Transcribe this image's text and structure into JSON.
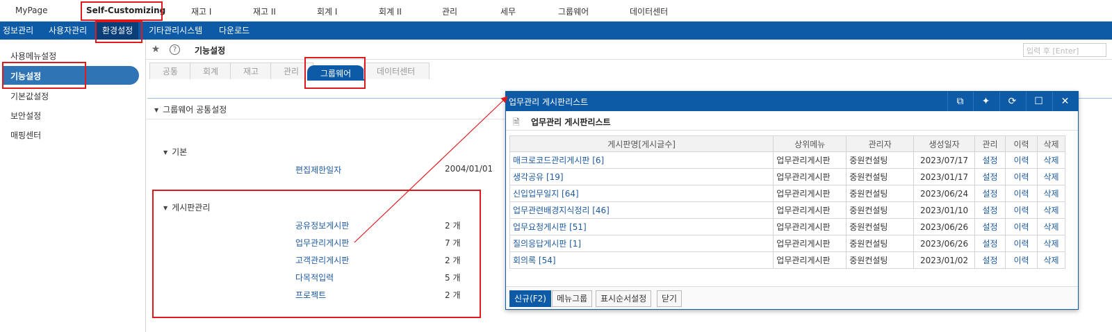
{
  "top_menu": [
    "MyPage",
    "Self-Customizing",
    "재고 I",
    "재고 II",
    "회계 I",
    "회계 II",
    "관리",
    "세무",
    "그룹웨어",
    "데이터센터"
  ],
  "sub_nav": [
    "정보관리",
    "사용자관리",
    "환경설정",
    "기타관리시스템",
    "다운로드"
  ],
  "sidebar": [
    "사용메뉴설정",
    "기능설정",
    "기본값설정",
    "보안설정",
    "매핑센터"
  ],
  "page": {
    "title": "기능설정",
    "search_placeholder": "입력 후 [Enter]"
  },
  "tabs": [
    "공통",
    "회계",
    "재고",
    "관리",
    "그룹웨어",
    "데이터센터"
  ],
  "settings": {
    "section_title": "그룹웨어 공통설정",
    "basic": {
      "title": "기본",
      "label": "편집제한일자",
      "value": "2004/01/01"
    },
    "board": {
      "title": "게시판관리",
      "items": [
        {
          "label": "공유정보게시판",
          "count": "2 개"
        },
        {
          "label": "업무관리게시판",
          "count": "7 개"
        },
        {
          "label": "고객관리게시판",
          "count": "2 개"
        },
        {
          "label": "다목적입력",
          "count": "5 개"
        },
        {
          "label": "프로젝트",
          "count": "2 개"
        }
      ]
    }
  },
  "modal": {
    "title": "업무관리 게시판리스트",
    "subtitle": "업무관리 게시판리스트",
    "columns": [
      "게시판명[게시글수]",
      "상위메뉴",
      "관리자",
      "생성일자",
      "관리",
      "이력",
      "삭제"
    ],
    "rows": [
      [
        "매크로코드관리게시판 [6]",
        "업무관리게시판",
        "중원컨설팅",
        "2023/07/17",
        "설정",
        "이력",
        "삭제"
      ],
      [
        "생각공유 [19]",
        "업무관리게시판",
        "중원컨설팅",
        "2023/01/17",
        "설정",
        "이력",
        "삭제"
      ],
      [
        "신입업무일지 [64]",
        "업무관리게시판",
        "중원컨설팅",
        "2023/06/24",
        "설정",
        "이력",
        "삭제"
      ],
      [
        "업무관련배경지식정리 [46]",
        "업무관리게시판",
        "중원컨설팅",
        "2023/01/10",
        "설정",
        "이력",
        "삭제"
      ],
      [
        "업무요청게시판 [51]",
        "업무관리게시판",
        "중원컨설팅",
        "2023/06/26",
        "설정",
        "이력",
        "삭제"
      ],
      [
        "질의응답게시판 [1]",
        "업무관리게시판",
        "중원컨설팅",
        "2023/06/26",
        "설정",
        "이력",
        "삭제"
      ],
      [
        "회의록 [54]",
        "업무관리게시판",
        "중원컨설팅",
        "2023/01/02",
        "설정",
        "이력",
        "삭제"
      ]
    ],
    "footer_buttons": [
      "신규(F2)",
      "메뉴그룹",
      "표시순서설정",
      "닫기"
    ]
  },
  "colors": {
    "primary": "#0d5aa7",
    "highlight": "#e0191b",
    "link": "#1e5aa0"
  }
}
